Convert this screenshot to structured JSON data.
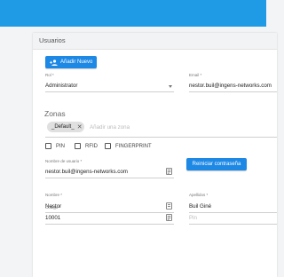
{
  "card": {
    "title": "Usuarios"
  },
  "toolbar": {
    "add_label": "Añadir Nuevo",
    "add_icon": "person-add-icon"
  },
  "form": {
    "rol": {
      "label": "Rol *",
      "value": "Administrator"
    },
    "email": {
      "label": "Email *",
      "value": "nestor.buil@ingens-networks.com"
    },
    "zonas": {
      "label": "Zonas",
      "chips": [
        "_Default_"
      ],
      "placeholder": "Añadir una zona"
    },
    "checkboxes": [
      "PIN",
      "RFID",
      "FINGERPRINT"
    ],
    "username": {
      "label": "Nombre de usuario *",
      "value": "nestor.buil@ingens-networks.com"
    },
    "reset_label": "Reiniciar contraseña",
    "nombre": {
      "label": "Nombre *",
      "value": "Nestor"
    },
    "apellidos": {
      "label": "Apellidos *",
      "value": "Buil Giné"
    },
    "codigo": {
      "label": "Código *",
      "value": "10001"
    },
    "pin": {
      "placeholder": "Pin"
    }
  },
  "colors": {
    "topbar": "#1f9be6",
    "button": "#1e88e5"
  }
}
